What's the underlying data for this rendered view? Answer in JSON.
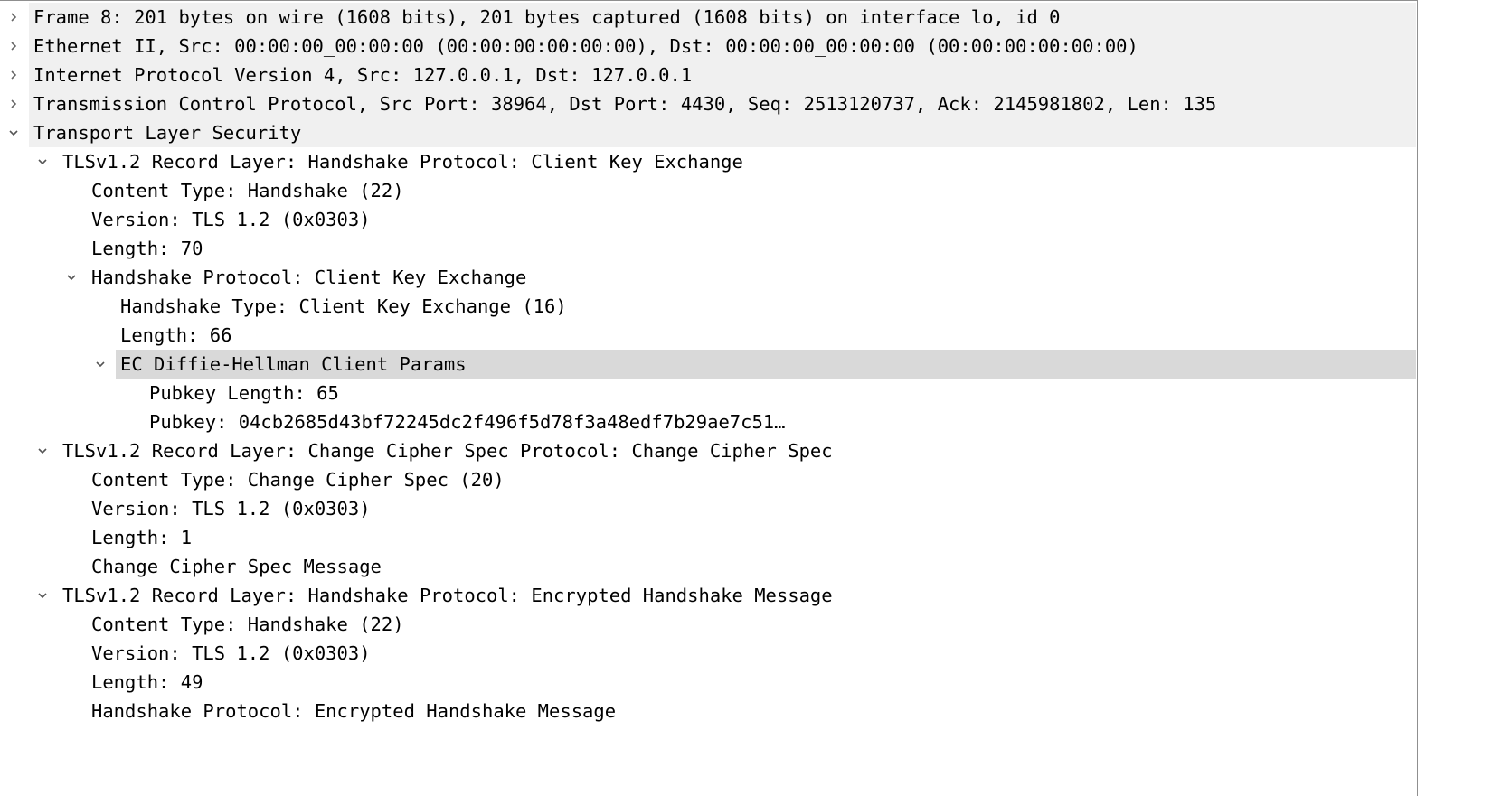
{
  "packet_details": {
    "rows": [
      {
        "level": 0,
        "state": "collapsed",
        "text": "Frame 8: 201 bytes on wire (1608 bits), 201 bytes captured (1608 bits) on interface lo, id 0"
      },
      {
        "level": 0,
        "state": "collapsed",
        "text": "Ethernet II, Src: 00:00:00_00:00:00 (00:00:00:00:00:00), Dst: 00:00:00_00:00:00 (00:00:00:00:00:00)"
      },
      {
        "level": 0,
        "state": "collapsed",
        "text": "Internet Protocol Version 4, Src: 127.0.0.1, Dst: 127.0.0.1"
      },
      {
        "level": 0,
        "state": "collapsed",
        "text": "Transmission Control Protocol, Src Port: 38964, Dst Port: 4430, Seq: 2513120737, Ack: 2145981802, Len: 135"
      },
      {
        "level": 0,
        "state": "expanded",
        "text": "Transport Layer Security"
      },
      {
        "level": 1,
        "state": "expanded",
        "text": "TLSv1.2 Record Layer: Handshake Protocol: Client Key Exchange"
      },
      {
        "level": 2,
        "state": "leaf",
        "text": "Content Type: Handshake (22)"
      },
      {
        "level": 2,
        "state": "leaf",
        "text": "Version: TLS 1.2 (0x0303)"
      },
      {
        "level": 2,
        "state": "leaf",
        "text": "Length: 70"
      },
      {
        "level": 2,
        "state": "expanded",
        "text": "Handshake Protocol: Client Key Exchange"
      },
      {
        "level": 3,
        "state": "leaf",
        "text": "Handshake Type: Client Key Exchange (16)"
      },
      {
        "level": 3,
        "state": "leaf",
        "text": "Length: 66"
      },
      {
        "level": 3,
        "state": "expanded",
        "selected": true,
        "text": "EC Diffie-Hellman Client Params"
      },
      {
        "level": 4,
        "state": "leaf",
        "text": "Pubkey Length: 65"
      },
      {
        "level": 4,
        "state": "leaf",
        "text": "Pubkey: 04cb2685d43bf72245dc2f496f5d78f3a48edf7b29ae7c51…"
      },
      {
        "level": 1,
        "state": "expanded",
        "text": "TLSv1.2 Record Layer: Change Cipher Spec Protocol: Change Cipher Spec"
      },
      {
        "level": 2,
        "state": "leaf",
        "text": "Content Type: Change Cipher Spec (20)"
      },
      {
        "level": 2,
        "state": "leaf",
        "text": "Version: TLS 1.2 (0x0303)"
      },
      {
        "level": 2,
        "state": "leaf",
        "text": "Length: 1"
      },
      {
        "level": 2,
        "state": "leaf",
        "text": "Change Cipher Spec Message"
      },
      {
        "level": 1,
        "state": "expanded",
        "text": "TLSv1.2 Record Layer: Handshake Protocol: Encrypted Handshake Message"
      },
      {
        "level": 2,
        "state": "leaf",
        "text": "Content Type: Handshake (22)"
      },
      {
        "level": 2,
        "state": "leaf",
        "text": "Version: TLS 1.2 (0x0303)"
      },
      {
        "level": 2,
        "state": "leaf",
        "text": "Length: 49"
      },
      {
        "level": 2,
        "state": "leaf",
        "text": "Handshake Protocol: Encrypted Handshake Message"
      }
    ]
  }
}
